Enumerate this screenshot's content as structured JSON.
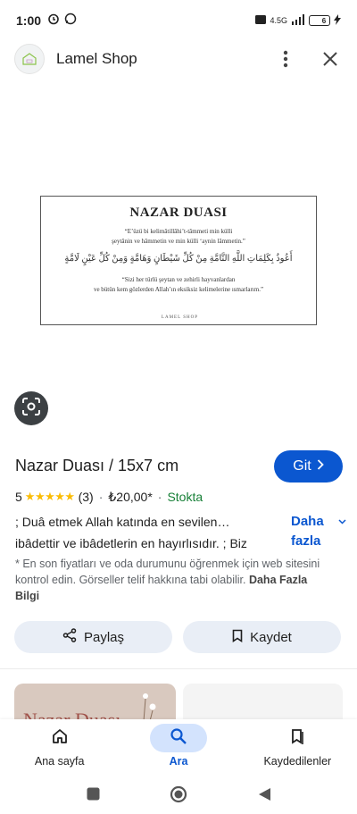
{
  "status_bar": {
    "time": "1:00",
    "network": "4.5G",
    "battery": "6"
  },
  "header": {
    "shop_name": "Lamel Shop",
    "logo_icon": "shop-logo-icon",
    "menu_icon": "more-vert-icon",
    "close_icon": "close-icon"
  },
  "product_image": {
    "title": "NAZAR DUASI",
    "line1": "“E’üzü bi kelimâtillâhi’t-tâmmeti min külli",
    "line2": "şeytânin ve hâmmetin ve min külli ‘aynin lâmmetin.”",
    "arabic": "أَعُوذُ بِكَلِمَاتِ اللَّهِ التَّامَّةِ مِنْ كُلِّ شَيْطَانٍ وَهَامَّةٍ وَمِنْ كُلِّ عَيْنٍ لَامَّةٍ",
    "meaning1": "“Sizi her türlü şeytan ve zehirli hayvanlardan",
    "meaning2": "ve bütün kem gözlerden Allah’ın eksiksiz kelimelerine ısmarlarım.”",
    "brand": "LAMEL SHOP"
  },
  "product": {
    "title": "Nazar Duası / 15x7 cm",
    "go_label": "Git",
    "rating": "5",
    "stars": "★★★★★",
    "reviews": "(3)",
    "separator": "·",
    "price": "₺20,00*",
    "stock": "Stokta",
    "desc_line1": "; Duâ etmek Allah katında en sevilen…",
    "desc_line2": "ibâdettir ve ibâdetlerin en hayırlısıdır. ; Biz",
    "more_line1": "Daha",
    "more_line2": "fazla",
    "disclaimer": "* En son fiyatları ve oda durumunu öğrenmek için web sitesini kontrol edin. Görseller telif hakkına tabi olabilir.",
    "disclaimer_link": "Daha Fazla Bilgi",
    "share_label": "Paylaş",
    "save_label": "Kaydet"
  },
  "related": {
    "card1_text": "Nazar Duası"
  },
  "bottom_nav": {
    "items": [
      {
        "label": "Ana sayfa",
        "icon": "home-icon"
      },
      {
        "label": "Ara",
        "icon": "search-icon"
      },
      {
        "label": "Kaydedilenler",
        "icon": "bookmarks-icon"
      }
    ],
    "active_index": 1
  },
  "colors": {
    "accent": "#0b57d0",
    "stock": "#188038",
    "star": "#fbbc04",
    "pill": "#e9eef6"
  }
}
